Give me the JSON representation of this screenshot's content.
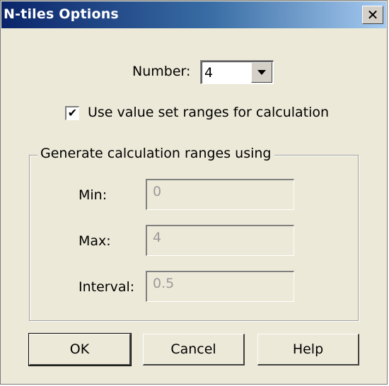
{
  "window": {
    "title": "N-tiles Options",
    "close_label": "✕"
  },
  "number": {
    "label": "Number:",
    "value": "4"
  },
  "use_value_set": {
    "checked": true,
    "check_glyph": "✔",
    "label": "Use value set ranges for calculation"
  },
  "group": {
    "title": "Generate calculation ranges using",
    "min": {
      "label": "Min:",
      "value": "0"
    },
    "max": {
      "label": "Max:",
      "value": "4"
    },
    "interval": {
      "label": "Interval:",
      "value": "0.5"
    }
  },
  "buttons": {
    "ok": "OK",
    "cancel": "Cancel",
    "help": "Help"
  },
  "colors": {
    "title_bar_start": "#0a246a",
    "title_bar_end": "#a6caf0",
    "dialog_background": "#ece9d8",
    "disabled_text": "#9a9a9a"
  }
}
